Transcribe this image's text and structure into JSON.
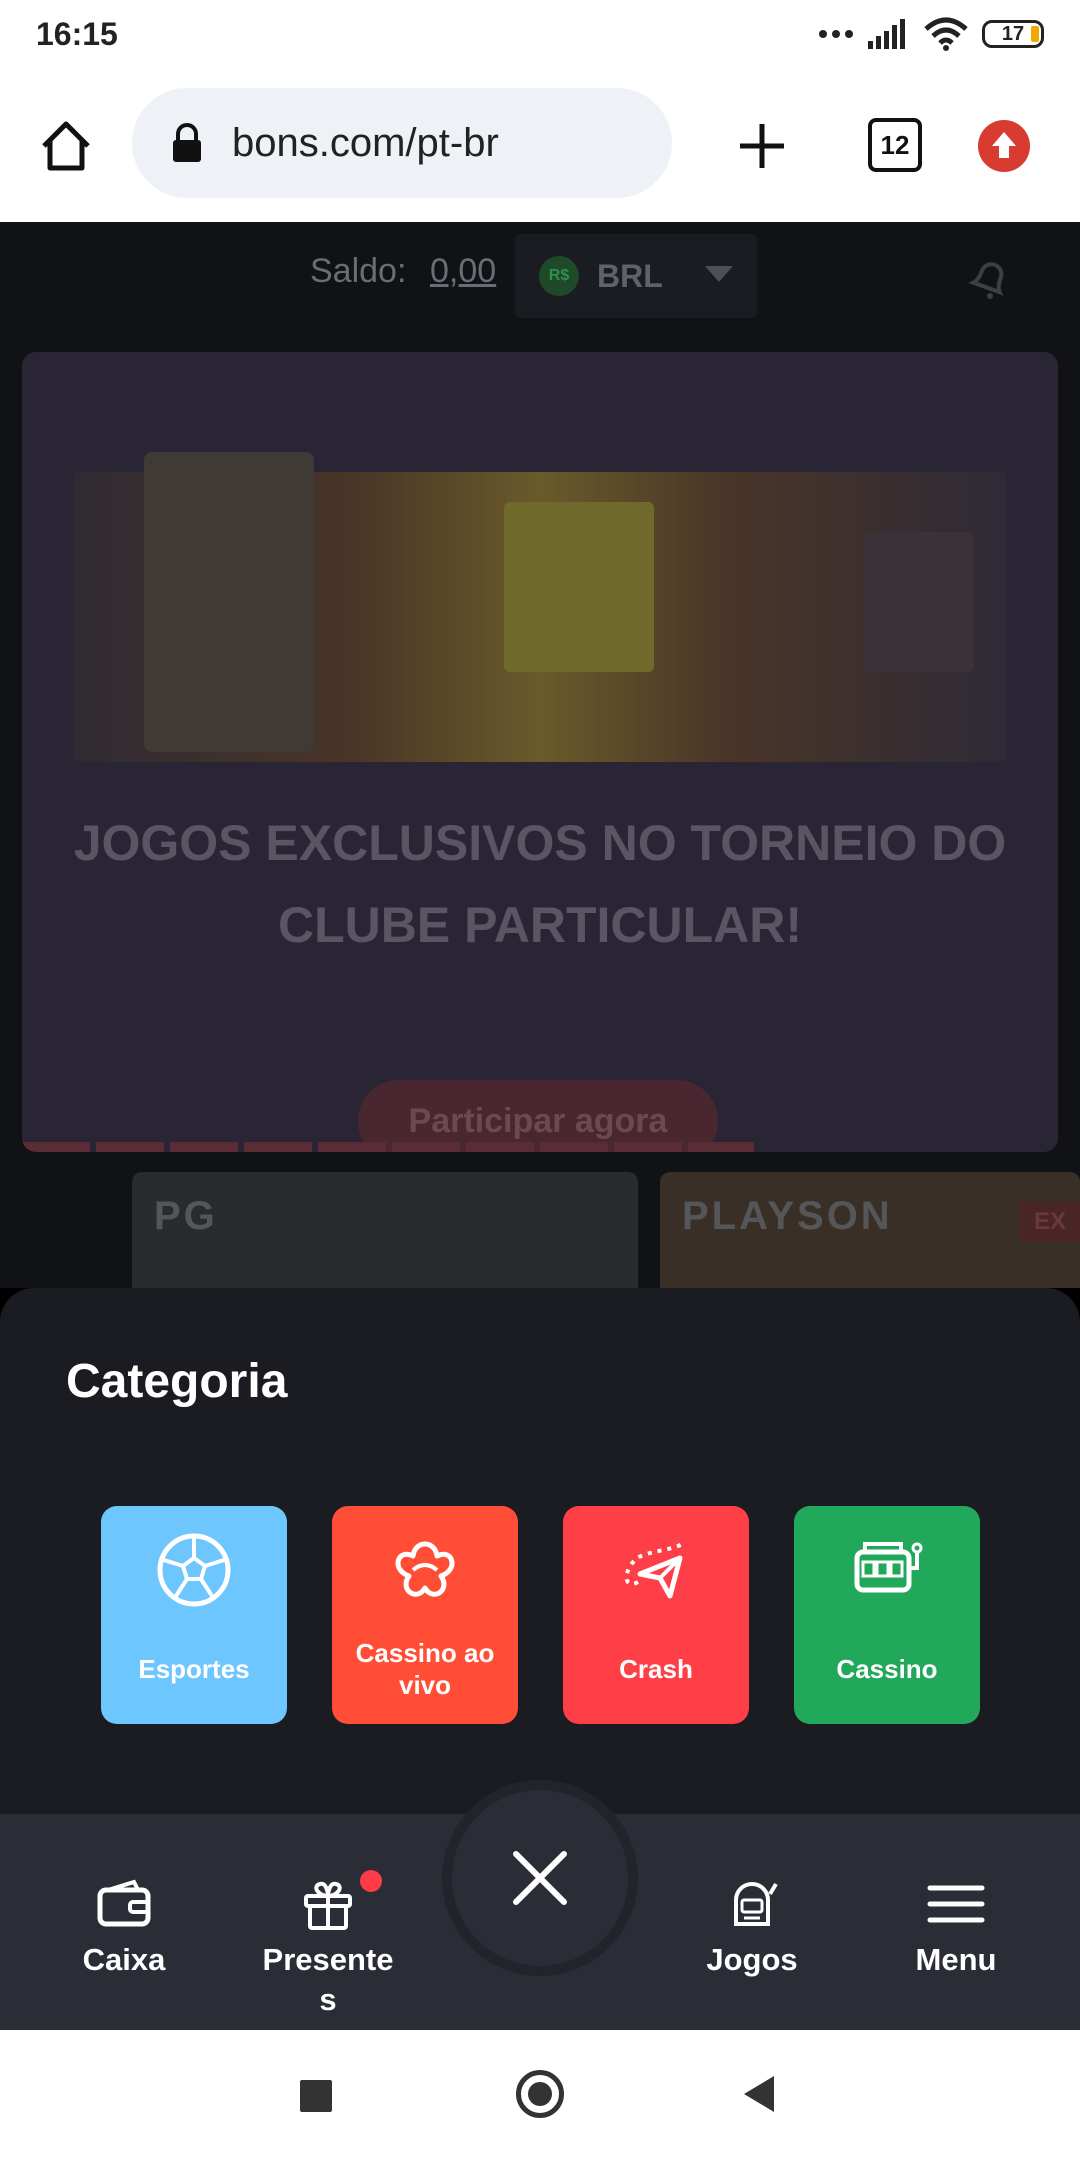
{
  "status_bar": {
    "time": "16:15",
    "battery": "17",
    "icons": [
      "dots-icon",
      "signal-icon",
      "wifi-icon",
      "battery-icon"
    ]
  },
  "browser": {
    "url": "bons.com/pt-br",
    "tab_count": "12",
    "icons": [
      "home-icon",
      "lock-icon",
      "plus-icon",
      "tabs-icon",
      "update-icon"
    ]
  },
  "header": {
    "saldo_label": "Saldo:",
    "saldo_value": "0,00",
    "currency_symbol": "R$",
    "currency": "BRL"
  },
  "banner": {
    "title_line1": "JOGOS EXCLUSIVOS NO TORNEIO DO",
    "title_line2": "CLUBE PARTICULAR!",
    "cta": "Participar agora",
    "slides_total": 10,
    "active_slides": 10
  },
  "providers": [
    {
      "logo": "PG"
    },
    {
      "logo": "PLAYSON",
      "badge": "EX"
    }
  ],
  "sheet": {
    "title": "Categoria",
    "categories": [
      {
        "label": "Esportes",
        "color": "#6ec6ff",
        "icon": "soccer-ball-icon"
      },
      {
        "label": "Cassino ao vivo",
        "color": "#ff4d36",
        "icon": "cards-icon"
      },
      {
        "label": "Crash",
        "color": "#ff3f47",
        "icon": "paper-plane-icon"
      },
      {
        "label": "Cassino",
        "color": "#22a85a",
        "icon": "slot-machine-icon"
      }
    ]
  },
  "bottom_nav": {
    "items": [
      {
        "label": "Caixa",
        "icon": "wallet-icon"
      },
      {
        "label": "Presente\ns",
        "icon": "gift-icon"
      },
      {
        "label": "Jogos",
        "icon": "joystick-icon"
      },
      {
        "label": "Menu",
        "icon": "hamburger-icon"
      }
    ],
    "close_icon": "close-icon"
  },
  "colors": {
    "accent_red": "#d83b2f",
    "nav_bg": "#2a2d36",
    "sheet_bg": "#1b1c22"
  }
}
